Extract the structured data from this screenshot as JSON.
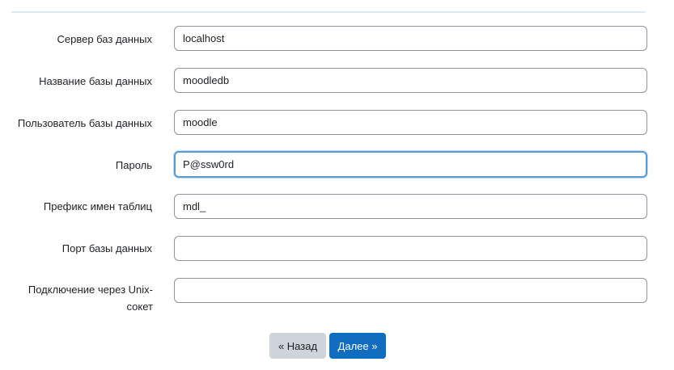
{
  "form": {
    "fields": [
      {
        "label": "Сервер баз данных",
        "value": "localhost"
      },
      {
        "label": "Название базы данных",
        "value": "moodledb"
      },
      {
        "label": "Пользователь базы данных",
        "value": "moodle"
      },
      {
        "label": "Пароль",
        "value": "P@ssw0rd"
      },
      {
        "label": "Префикс имен таблиц",
        "value": "mdl_"
      },
      {
        "label": "Порт базы данных",
        "value": ""
      },
      {
        "label": "Подключение через Unix-сокет",
        "value": ""
      }
    ]
  },
  "buttons": {
    "back_label": "« Назад",
    "next_label": "Далее »"
  },
  "colors": {
    "primary": "#0f6cbf",
    "secondary": "#ced4da",
    "focus_border": "#5b9bd5",
    "input_border": "#8f959e",
    "divider": "#d8ebf1"
  }
}
